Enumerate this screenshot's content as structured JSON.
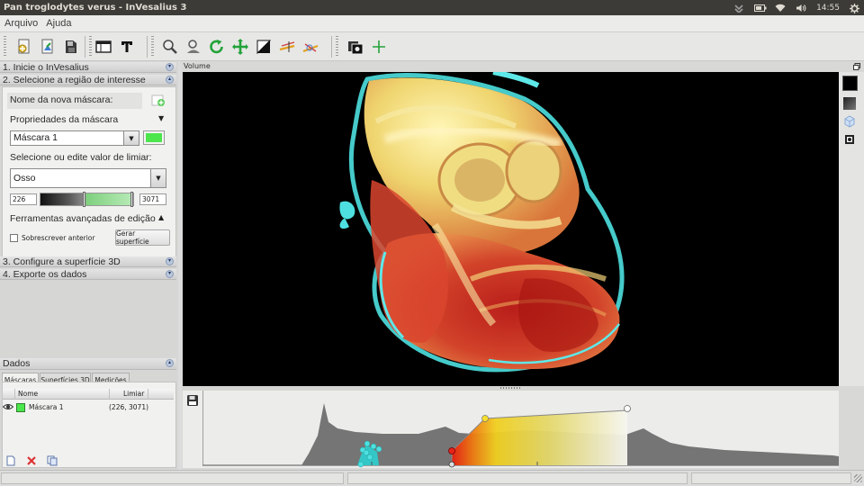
{
  "window": {
    "title": "Pan troglodytes verus - InVesalius 3"
  },
  "system_tray": {
    "time": "14:55",
    "icons": [
      "download-icon",
      "battery-icon",
      "wifi-icon",
      "volume-icon",
      "gear-icon"
    ]
  },
  "menubar": {
    "items": [
      "Arquivo",
      "Ajuda"
    ]
  },
  "toolbar": {
    "groups": [
      [
        "import-icon",
        "open-icon",
        "save-icon"
      ],
      [
        "window-layout-icon",
        "text-icon"
      ],
      [
        "zoom-icon",
        "zoom-select-icon",
        "rotate-icon",
        "move-icon",
        "contrast-icon",
        "measure-linear-icon",
        "measure-angle-icon"
      ],
      [
        "snapshot-icon",
        "crosshair-icon"
      ]
    ]
  },
  "left_panel": {
    "step1": "1. Inicie o InVesalius",
    "step2": "2. Selecione a região de interesse",
    "step3": "3. Configure a superfície 3D",
    "step4": "4. Exporte os dados",
    "new_mask_label": "Nome da nova máscara:",
    "mask_properties_label": "Propriedades da máscara",
    "mask_name": "Máscara 1",
    "mask_color": "#4ce64c",
    "threshold_label": "Selecione ou edite valor de limiar:",
    "threshold_preset": "Osso",
    "threshold_min": "226",
    "threshold_max": "3071",
    "advanced_tools_label": "Ferramentas avançadas de edição",
    "overwrite_label": "Sobrescrever anterior",
    "generate_surface_button": "Gerar superfície",
    "overwrite_checked": false
  },
  "data_panel": {
    "title": "Dados",
    "tabs": [
      "Máscaras",
      "Superfícies 3D",
      "Medições"
    ],
    "active_tab": "Máscaras",
    "columns": [
      "Nome",
      "Limiar"
    ],
    "rows": [
      {
        "name": "Máscara 1",
        "threshold": "(226, 3071)",
        "color": "#4ce64c",
        "visible": true
      }
    ]
  },
  "viewer": {
    "label": "Volume",
    "background": "#000000"
  }
}
